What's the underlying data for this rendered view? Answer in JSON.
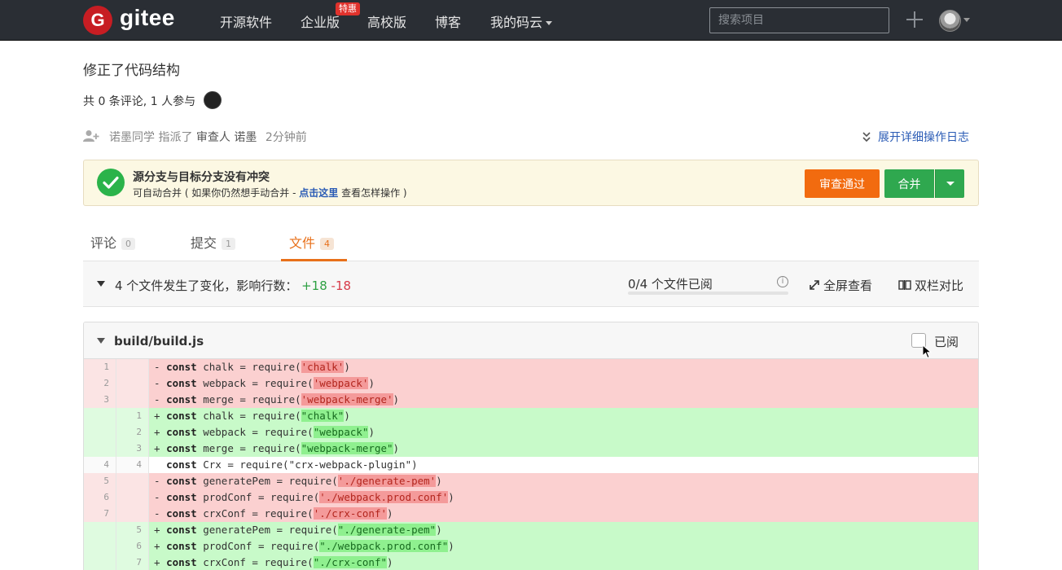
{
  "navbar": {
    "logo_letter": "G",
    "logo_text": "gitee",
    "items": [
      "开源软件",
      "企业版",
      "高校版",
      "博客",
      "我的码云"
    ],
    "badge": "特惠",
    "search_placeholder": "搜索项目"
  },
  "pr": {
    "title": "修正了代码结构",
    "meta": "共 0 条评论, 1 人参与",
    "assign_actor": "诺墨同学",
    "assign_verb": "指派了",
    "assign_role": "审查人",
    "assign_target": "诺墨",
    "assign_time": "2分钟前",
    "expand_log": "展开详细操作日志"
  },
  "merge_banner": {
    "title": "源分支与目标分支没有冲突",
    "sub_prefix": "可自动合并 ( 如果你仍然想手动合并 - ",
    "sub_link": "点击这里",
    "sub_suffix": " 查看怎样操作 )",
    "review_button": "审查通过",
    "merge_button": "合并"
  },
  "tabs": [
    {
      "label": "评论",
      "count": "0"
    },
    {
      "label": "提交",
      "count": "1"
    },
    {
      "label": "文件",
      "count": "4"
    }
  ],
  "summary": {
    "text": "4 个文件发生了变化，影响行数：",
    "additions": "+18",
    "deletions": "-18",
    "viewed": "0/4 个文件已阅",
    "viewed_fraction": 0,
    "fullscreen": "全屏查看",
    "split_view": "双栏对比"
  },
  "file": {
    "name": "build/build.js",
    "viewed_label": "已阅",
    "lines": [
      {
        "type": "del",
        "old": "1",
        "new": "",
        "sign": "-",
        "kw": "const",
        "pre": " chalk = require(",
        "str": "'chalk'",
        "post": ")"
      },
      {
        "type": "del",
        "old": "2",
        "new": "",
        "sign": "-",
        "kw": "const",
        "pre": " webpack = require(",
        "str": "'webpack'",
        "post": ")"
      },
      {
        "type": "del",
        "old": "3",
        "new": "",
        "sign": "-",
        "kw": "const",
        "pre": " merge = require(",
        "str": "'webpack-merge'",
        "post": ")"
      },
      {
        "type": "add",
        "old": "",
        "new": "1",
        "sign": "+",
        "kw": "const",
        "pre": " chalk = require(",
        "str": "\"chalk\"",
        "post": ")"
      },
      {
        "type": "add",
        "old": "",
        "new": "2",
        "sign": "+",
        "kw": "const",
        "pre": " webpack = require(",
        "str": "\"webpack\"",
        "post": ")"
      },
      {
        "type": "add",
        "old": "",
        "new": "3",
        "sign": "+",
        "kw": "const",
        "pre": " merge = require(",
        "str": "\"webpack-merge\"",
        "post": ")"
      },
      {
        "type": "ctx",
        "old": "4",
        "new": "4",
        "sign": " ",
        "kw": "const",
        "pre": " Crx = require(",
        "str": "\"crx-webpack-plugin\"",
        "post": ")"
      },
      {
        "type": "del",
        "old": "5",
        "new": "",
        "sign": "-",
        "kw": "const",
        "pre": " generatePem = require(",
        "str": "'./generate-pem'",
        "post": ")"
      },
      {
        "type": "del",
        "old": "6",
        "new": "",
        "sign": "-",
        "kw": "const",
        "pre": " prodConf = require(",
        "str": "'./webpack.prod.conf'",
        "post": ")"
      },
      {
        "type": "del",
        "old": "7",
        "new": "",
        "sign": "-",
        "kw": "const",
        "pre": " crxConf = require(",
        "str": "'./crx-conf'",
        "post": ")"
      },
      {
        "type": "add",
        "old": "",
        "new": "5",
        "sign": "+",
        "kw": "const",
        "pre": " generatePem = require(",
        "str": "\"./generate-pem\"",
        "post": ")"
      },
      {
        "type": "add",
        "old": "",
        "new": "6",
        "sign": "+",
        "kw": "const",
        "pre": " prodConf = require(",
        "str": "\"./webpack.prod.conf\"",
        "post": ")"
      },
      {
        "type": "add",
        "old": "",
        "new": "7",
        "sign": "+",
        "kw": "const",
        "pre": " crxConf = require(",
        "str": "\"./crx-conf\"",
        "post": ")"
      }
    ]
  },
  "colors": {
    "navbar_bg": "#2a2e34",
    "brand_red": "#c71d23",
    "accent_orange": "#e8701a",
    "merge_green": "#2fa84f",
    "review_orange": "#f26b0f",
    "link_blue": "#2a5bb5"
  }
}
